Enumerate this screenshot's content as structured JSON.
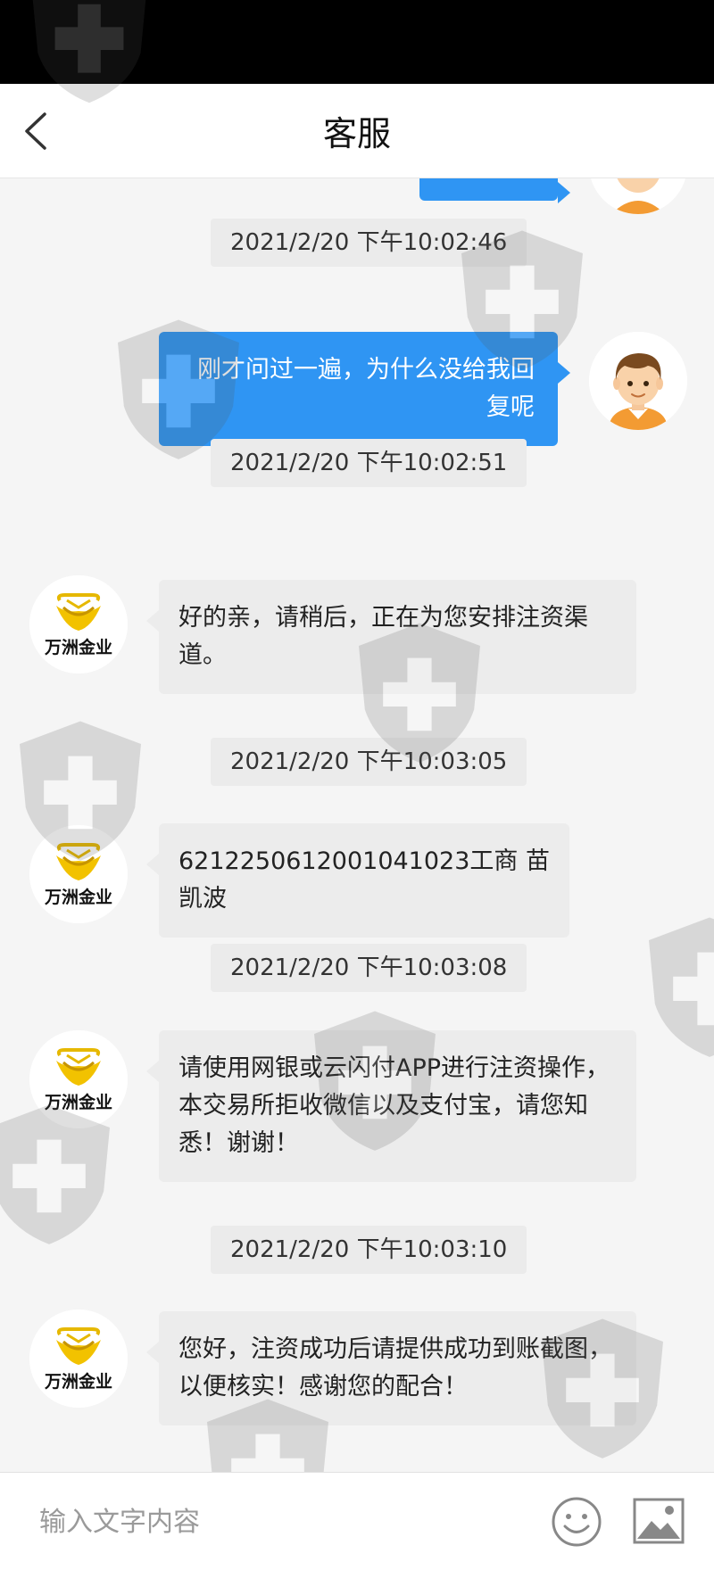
{
  "header": {
    "title": "客服"
  },
  "messages": [
    {
      "timestamp": "2021/2/20 下午10:02:46",
      "side": "right",
      "text": "刚才问过一遍，为什么没给我回复呢"
    },
    {
      "timestamp": "2021/2/20 下午10:02:51",
      "side": "left",
      "text": "好的亲，请稍后，正在为您安排注资渠道。"
    },
    {
      "timestamp": "2021/2/20 下午10:03:05",
      "side": "left",
      "text": "6212250612001041023工商 苗凯波"
    },
    {
      "timestamp": "2021/2/20 下午10:03:08",
      "side": "left",
      "text": "请使用网银或云闪付APP进行注资操作，本交易所拒收微信以及支付宝，请您知悉！谢谢！"
    },
    {
      "timestamp": "2021/2/20 下午10:03:10",
      "side": "left",
      "text": "您好，注资成功后请提供成功到账截图，以便核实！感谢您的配合！"
    }
  ],
  "agent": {
    "logo_text": "万洲金业"
  },
  "input": {
    "placeholder": "输入文字内容"
  },
  "icons": {
    "back": "back-arrow-icon",
    "emoji": "smiley-icon",
    "image": "image-icon",
    "user_avatar": "user-avatar-icon",
    "agent_avatar": "company-logo-icon",
    "watermark": "shield-cross-icon"
  },
  "colors": {
    "accent": "#2f95f3",
    "header_bg": "#ffffff",
    "chat_bg": "#f5f5f5",
    "left_bubble": "#ececec",
    "logo_gold": "#e6b800"
  }
}
